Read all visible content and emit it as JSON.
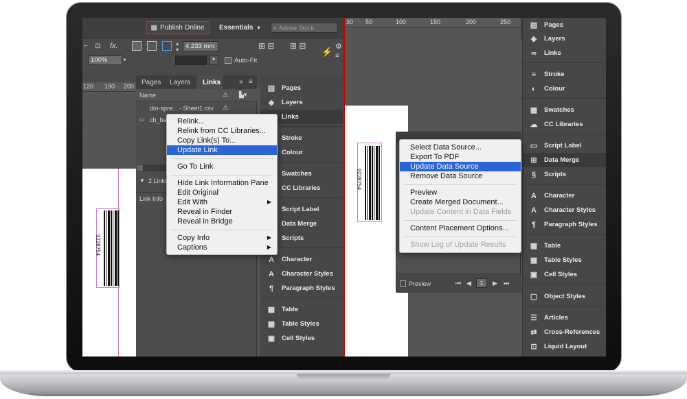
{
  "topbar": {
    "publish_label": "Publish Online",
    "workspace_label": "Essentials",
    "search_placeholder": "Adobe Stock"
  },
  "control": {
    "fx_label": "fx.",
    "dimension_value": "4,233 mm",
    "zoom_value": "100%",
    "autofit_label": "Auto-Fit"
  },
  "ruler_left": [
    "120",
    "190",
    "200"
  ],
  "ruler_right": [
    "30",
    "50",
    "100",
    "150",
    "200",
    "250"
  ],
  "links_panel": {
    "tabs": [
      "Pages",
      "Layers",
      "Links"
    ],
    "name_header": "Name",
    "rows": [
      "dm-spre... - Sheet1.csv",
      "cb_beta"
    ],
    "count": "2 Links",
    "info_label": "Link Info"
  },
  "context_menu": {
    "items": [
      "Relink...",
      "Relink from CC Libraries...",
      "Copy Link(s) To...",
      "Update Link",
      "Go To Link",
      "Hide Link Information Pane",
      "Edit Original",
      "Edit With",
      "Reveal in Finder",
      "Reveal in Bridge",
      "Copy Info",
      "Captions"
    ]
  },
  "mid_panels": [
    "Pages",
    "Layers",
    "Links",
    "Stroke",
    "Colour",
    "Swatches",
    "CC Libraries",
    "Script Label",
    "Data Merge",
    "Scripts",
    "Character",
    "Character Styles",
    "Paragraph Styles",
    "Table",
    "Table Styles",
    "Cell Styles"
  ],
  "right_panels": [
    "Pages",
    "Layers",
    "Links",
    "Stroke",
    "Colour",
    "Swatches",
    "CC Libraries",
    "Script Label",
    "Data Merge",
    "Scripts",
    "Character",
    "Character Styles",
    "Paragraph Styles",
    "Table",
    "Table Styles",
    "Cell Styles",
    "Object Styles",
    "Articles",
    "Cross-References",
    "Liquid Layout"
  ],
  "data_merge_menu": {
    "items": [
      "Select Data Source...",
      "Export To PDF",
      "Update Data Source",
      "Remove Data Source",
      "Preview",
      "Create Merged Document...",
      "Update Content in Data Fields",
      "Content Placement Options...",
      "Show Log of Update Results"
    ],
    "preview_label": "Preview",
    "page_value": "1"
  },
  "barcode_text": "9228754",
  "colors": {
    "highlight": "#2a64d9",
    "divider": "#cc0000",
    "publish_border": "#c0392b"
  }
}
